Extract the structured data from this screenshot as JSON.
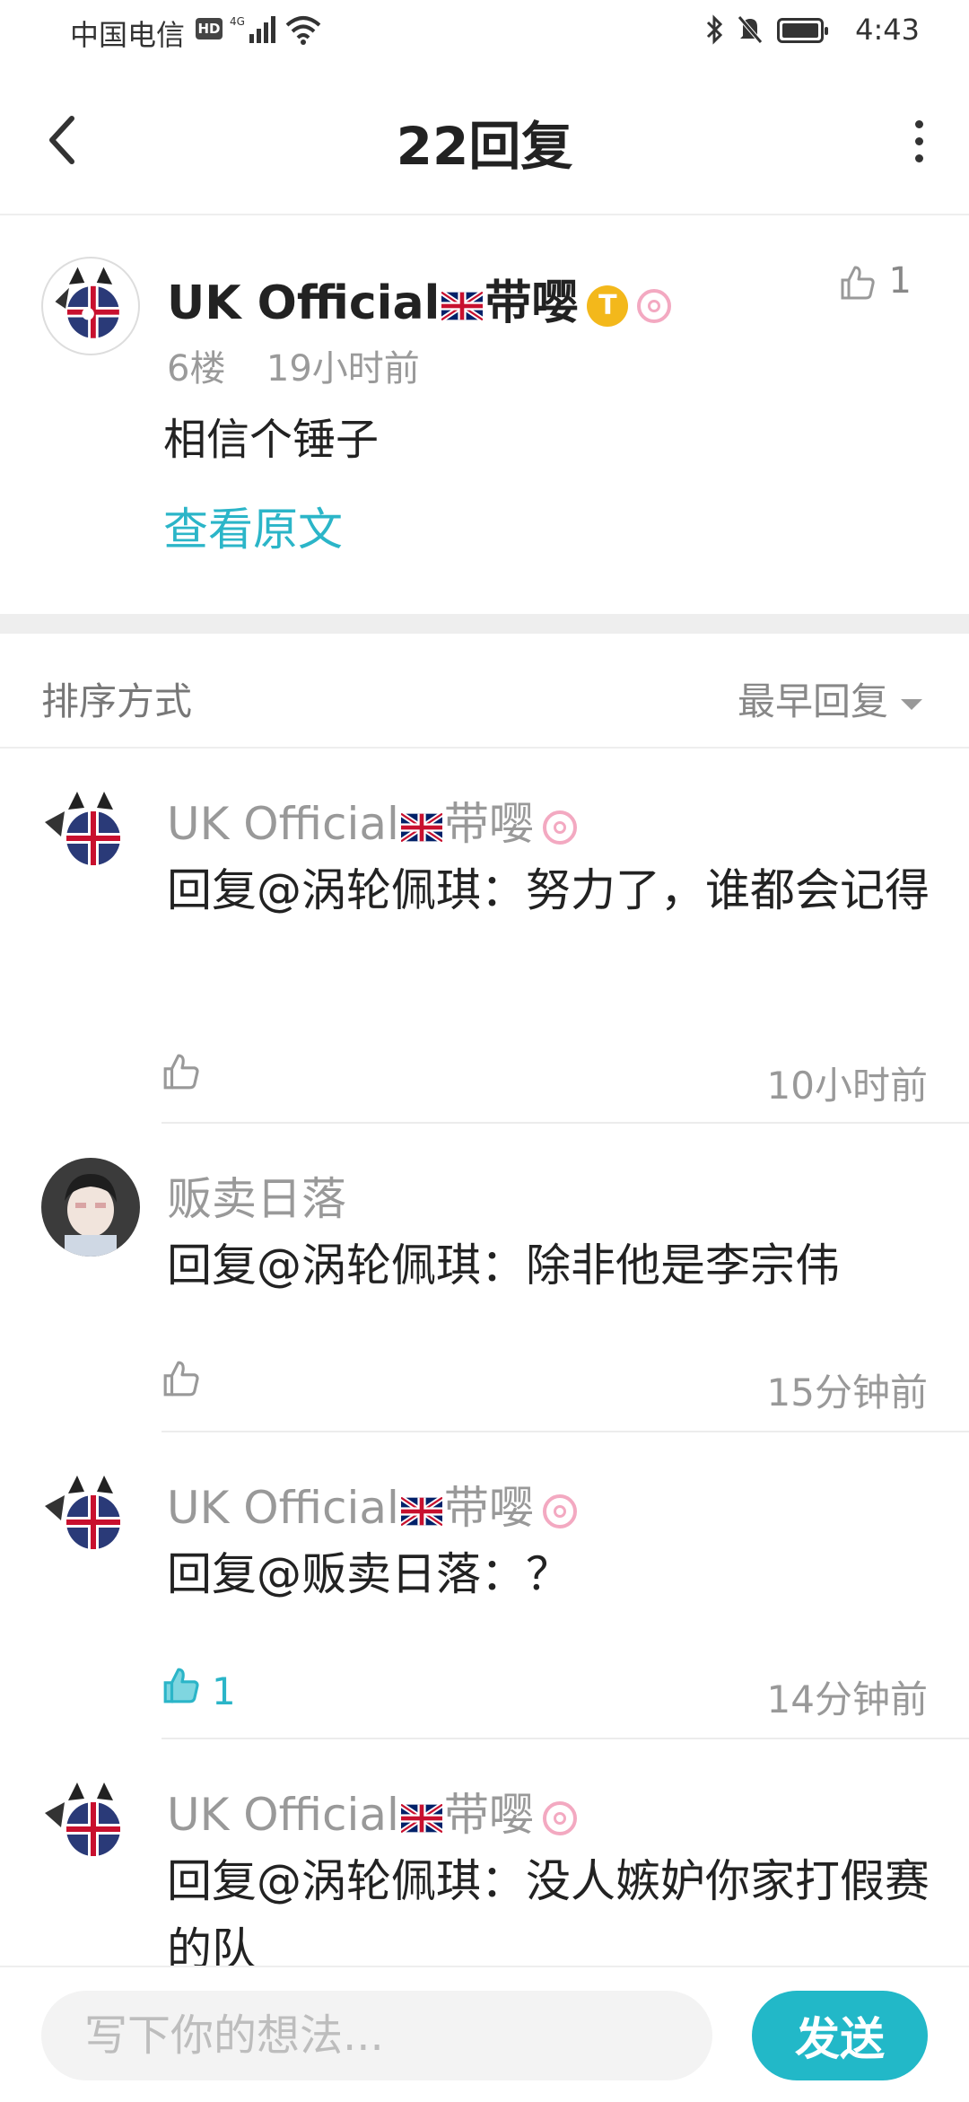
{
  "status_bar": {
    "carrier": "中国电信",
    "hd": "HD",
    "network": "4G",
    "time": "4:43"
  },
  "header": {
    "title": "22回复"
  },
  "main_post": {
    "author": "UK Official",
    "author_suffix": "带嘤",
    "badge_letter": "T",
    "floor": "6楼",
    "time": "19小时前",
    "content": "相信个锤子",
    "view_original": "查看原文",
    "likes": "1"
  },
  "sort": {
    "label": "排序方式",
    "value": "最早回复"
  },
  "replies": [
    {
      "author": "UK Official",
      "author_suffix": "带嘤",
      "text": "回复@涡轮佩琪：努力了，谁都会记得",
      "time": "10小时前",
      "likes": ""
    },
    {
      "author": "贩卖日落",
      "author_suffix": "",
      "text": "回复@涡轮佩琪：除非他是李宗伟",
      "time": "15分钟前",
      "likes": ""
    },
    {
      "author": "UK Official",
      "author_suffix": "带嘤",
      "text": "回复@贩卖日落：？",
      "time": "14分钟前",
      "likes": "1"
    },
    {
      "author": "UK Official",
      "author_suffix": "带嘤",
      "text": "回复@涡轮佩琪：没人嫉妒你家打假赛的队",
      "time": "",
      "likes": ""
    }
  ],
  "composer": {
    "placeholder": "写下你的想法...",
    "send_label": "发送"
  },
  "colors": {
    "accent": "#2bb5c8",
    "send_button": "#22b8c8"
  }
}
